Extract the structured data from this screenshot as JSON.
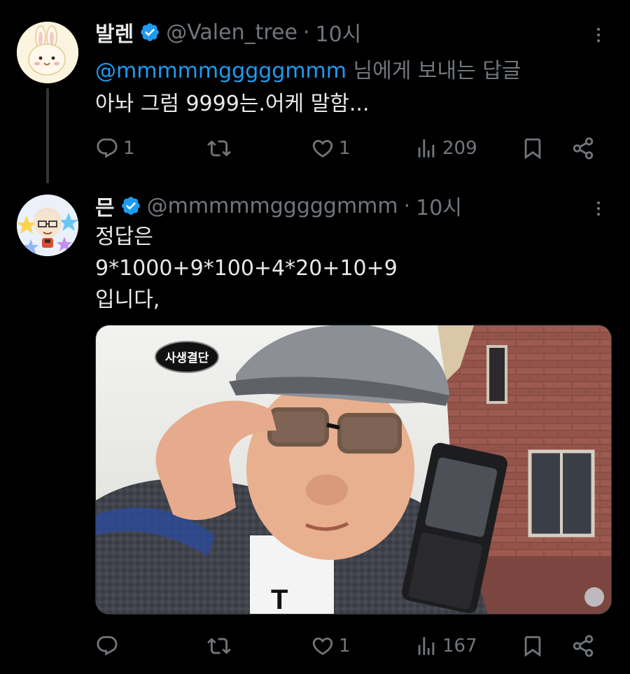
{
  "tweets": [
    {
      "display_name": "발렌",
      "handle": "@Valen_tree",
      "separator": "·",
      "time": "10시",
      "reply_to": {
        "mention": "@mmmmmgggggmmm",
        "suffix": " 님에게 보내는 답글"
      },
      "text_lines": [
        "아놔 그럼 9999는.어케 말함..."
      ],
      "actions": {
        "replies": "1",
        "retweets": "",
        "likes": "1",
        "views": "209"
      }
    },
    {
      "display_name": "믄",
      "handle": "@mmmmmgggggmmm",
      "separator": "·",
      "time": "10시",
      "text_lines": [
        "정답은",
        "9*1000+9*100+4*20+10+9",
        "입니다,"
      ],
      "media": {
        "description_icon": "photo-icon",
        "watermark_text": "사생결단"
      },
      "actions": {
        "replies": "",
        "retweets": "",
        "likes": "1",
        "views": "167"
      }
    }
  ],
  "colors": {
    "background": "#000000",
    "text": "#e7e9ea",
    "secondary": "#71767b",
    "link": "#1d9bf0",
    "verified": "#1d9bf0"
  },
  "icons": {
    "reply": "reply-icon",
    "retweet": "retweet-icon",
    "like": "heart-icon",
    "views": "views-icon",
    "bookmark": "bookmark-icon",
    "share": "share-icon",
    "more": "more-icon",
    "verified": "verified-badge-icon"
  }
}
